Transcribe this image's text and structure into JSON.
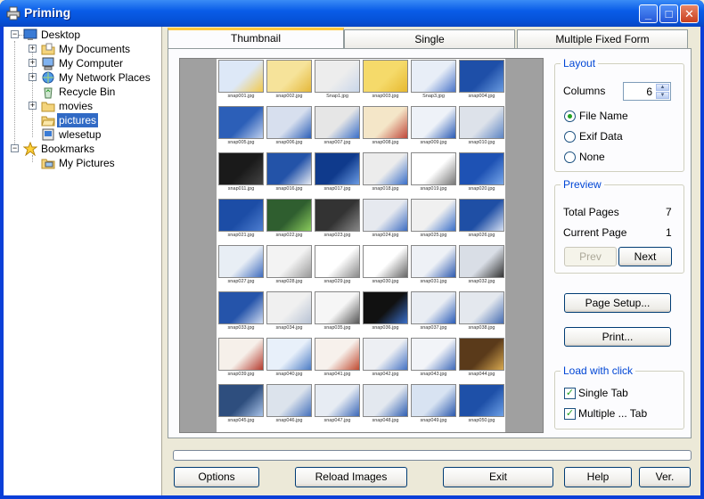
{
  "window": {
    "title": "Priming",
    "icon": "printer-icon"
  },
  "title_buttons": {
    "min": "_",
    "max": "□",
    "close": "✕"
  },
  "tree": {
    "desktop": "Desktop",
    "my_documents": "My Documents",
    "my_computer": "My Computer",
    "my_network": "My Network Places",
    "recycle_bin": "Recycle Bin",
    "movies": "movies",
    "pictures": "pictures",
    "wlesetup": "wlesetup",
    "bookmarks": "Bookmarks",
    "my_pictures": "My Pictures"
  },
  "tabs": {
    "thumbnail": "Thumbnail",
    "single": "Single",
    "multiple": "Multiple Fixed Form"
  },
  "thumbnails": [
    "snap001.jpg",
    "snap002.jpg",
    "Snap1.jpg",
    "snap003.jpg",
    "Snap3.jpg",
    "snap004.jpg",
    "snap005.jpg",
    "snap006.jpg",
    "snap007.jpg",
    "snap008.jpg",
    "snap009.jpg",
    "snap010.jpg",
    "snap011.jpg",
    "snap016.jpg",
    "snap017.jpg",
    "snap018.jpg",
    "snap019.jpg",
    "snap020.jpg",
    "snap021.jpg",
    "snap022.jpg",
    "snap023.jpg",
    "snap024.jpg",
    "snap025.jpg",
    "snap026.jpg",
    "snap027.jpg",
    "snap028.jpg",
    "snap029.jpg",
    "snap030.jpg",
    "snap031.jpg",
    "snap032.jpg",
    "snap033.jpg",
    "snap034.jpg",
    "snap035.jpg",
    "snap036.jpg",
    "snap037.jpg",
    "snap038.jpg",
    "snap039.jpg",
    "snap040.jpg",
    "snap041.jpg",
    "snap042.jpg",
    "snap043.jpg",
    "snap044.jpg",
    "snap045.jpg",
    "snap046.jpg",
    "snap047.jpg",
    "snap048.jpg",
    "snap049.jpg",
    "snap050.jpg"
  ],
  "layout": {
    "title": "Layout",
    "columns_label": "Columns",
    "columns_value": "6",
    "file_name": "File Name",
    "exif_data": "Exif Data",
    "none": "None",
    "selected": "file_name"
  },
  "preview": {
    "title": "Preview",
    "total_pages_label": "Total Pages",
    "total_pages_value": "7",
    "current_page_label": "Current Page",
    "current_page_value": "1",
    "prev": "Prev",
    "next": "Next"
  },
  "page_setup": "Page Setup...",
  "print": "Print...",
  "load_with_click": {
    "title": "Load with click",
    "single_tab": "Single Tab",
    "multiple_tab": "Multiple ... Tab",
    "single_checked": true,
    "multiple_checked": true
  },
  "bottom": {
    "options": "Options",
    "reload": "Reload Images",
    "exit": "Exit",
    "help": "Help",
    "ver": "Ver."
  },
  "colors": {
    "titlebar": "#0A5DE8",
    "selection": "#316AC5",
    "group_title": "#0046D5",
    "tab_highlight": "#FFC83C"
  }
}
